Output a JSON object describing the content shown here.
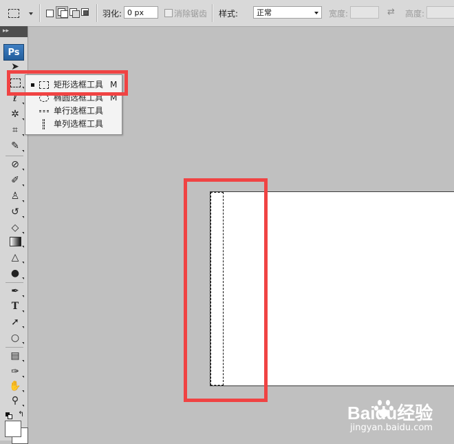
{
  "options_bar": {
    "feather_label": "羽化:",
    "feather_value": "0 px",
    "antialias_label": "消除锯齿",
    "style_label": "样式:",
    "style_value": "正常",
    "width_label": "宽度:",
    "height_label": "高度:"
  },
  "toolbox": {
    "logo": "Ps"
  },
  "flyout": {
    "items": [
      {
        "label": "矩形选框工具",
        "shortcut": "M",
        "selected": true,
        "icon": "rect-marquee-icon"
      },
      {
        "label": "椭圆选框工具",
        "shortcut": "M",
        "selected": false,
        "icon": "ellipse-marquee-icon"
      },
      {
        "label": "单行选框工具",
        "shortcut": "",
        "selected": false,
        "icon": "single-row-marquee-icon"
      },
      {
        "label": "单列选框工具",
        "shortcut": "",
        "selected": false,
        "icon": "single-column-marquee-icon"
      }
    ]
  },
  "watermark": {
    "brand": "Baidu经验",
    "site": "jingyan.baidu.com"
  },
  "colors": {
    "highlight": "#f04343",
    "canvas_bg": "#c0c0c0",
    "logo_blue": "#2f6fb3"
  }
}
